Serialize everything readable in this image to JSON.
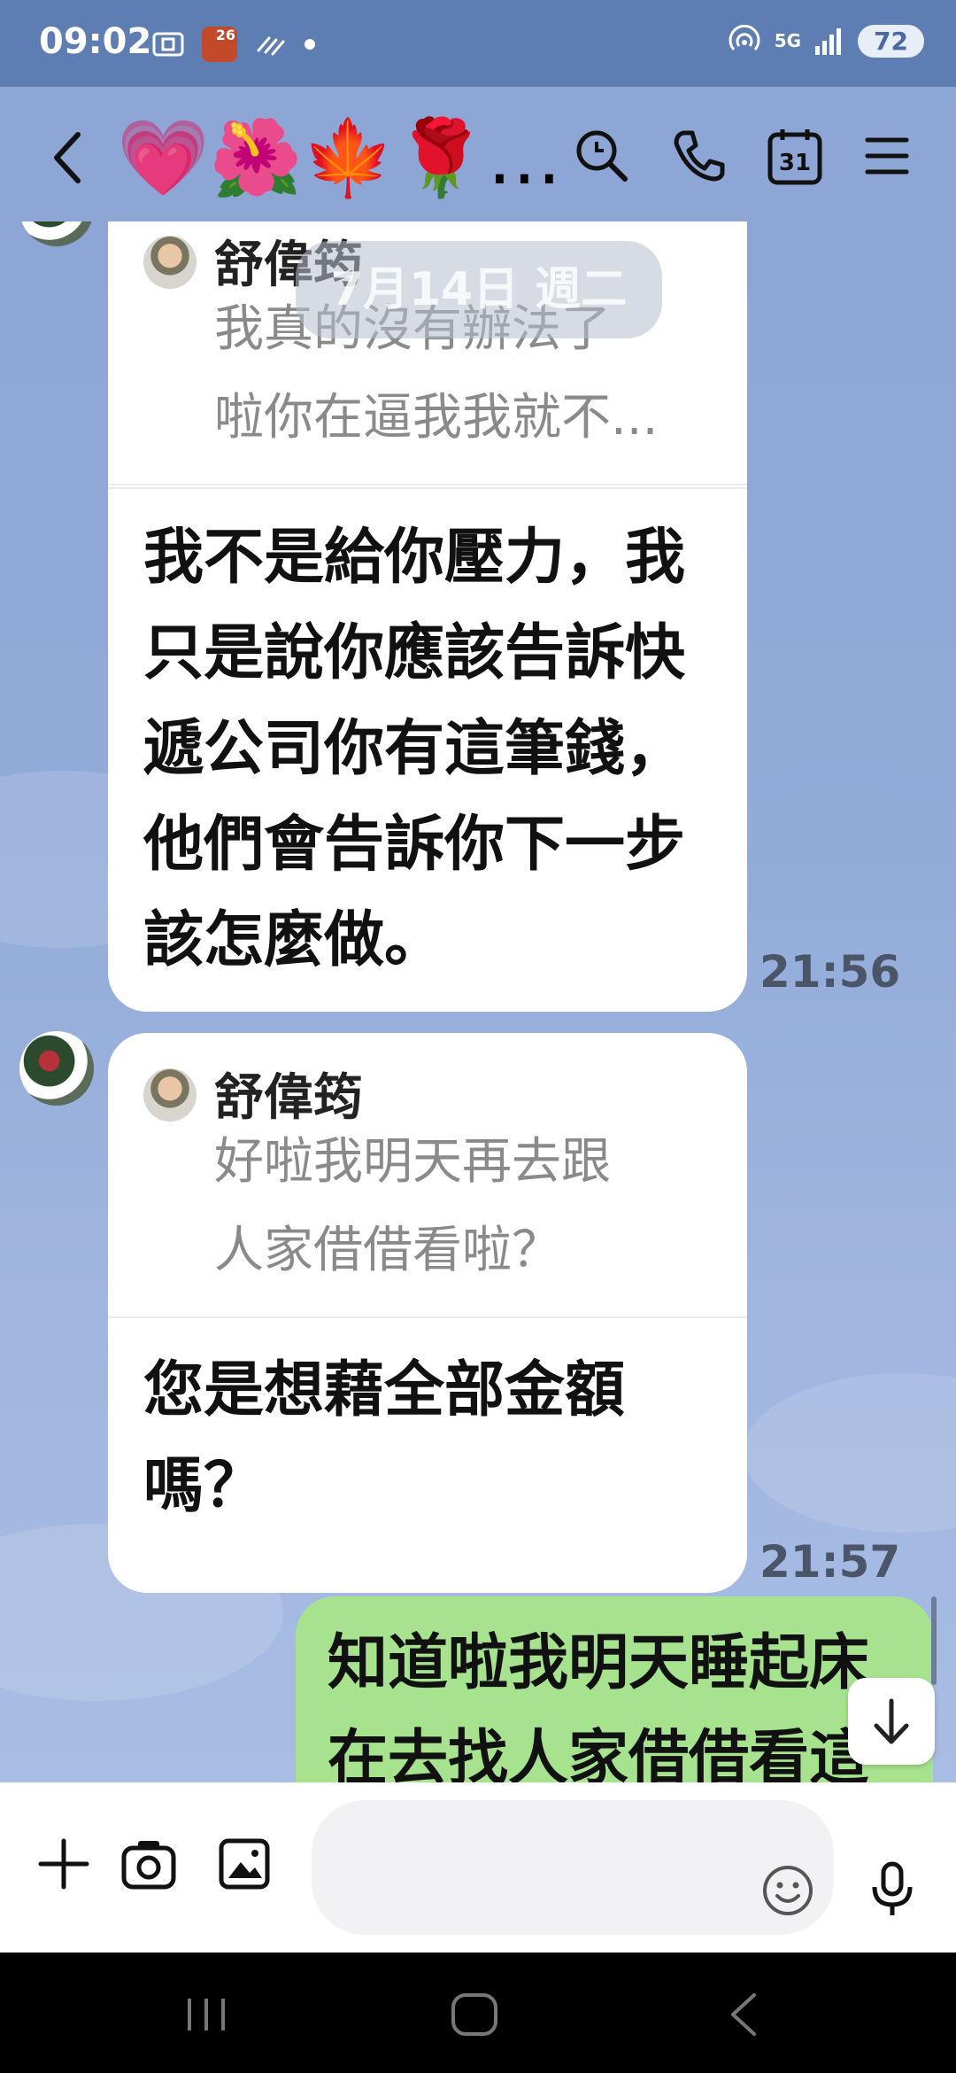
{
  "status_bar": {
    "time": "09:02",
    "badge": "26",
    "network": "5G",
    "battery": "72"
  },
  "header": {
    "title": "💗🌺🍁🌹…",
    "calendar_day": "31"
  },
  "chat": {
    "date_separator": "7月14日 週二",
    "messages": [
      {
        "quote_name": "舒偉筠",
        "quote_lines": [
          "我真的沒有辦法了",
          "啦你在逼我我就不..."
        ],
        "text_lines": [
          "我不是給你壓力，我",
          "只是說你應該告訴快",
          "遞公司你有這筆錢，",
          "他們會告訴你下一步",
          "該怎麼做。"
        ],
        "time": "21:56"
      },
      {
        "quote_name": "舒偉筠",
        "quote_lines": [
          "好啦我明天再去跟",
          "人家借借看啦？"
        ],
        "text_lines": [
          "您是想藉全部金額",
          "嗎？"
        ],
        "time": "21:57"
      }
    ],
    "outgoing": {
      "text_lines": [
        "知道啦我明天睡起床",
        "在去找人家借借看這"
      ]
    }
  }
}
